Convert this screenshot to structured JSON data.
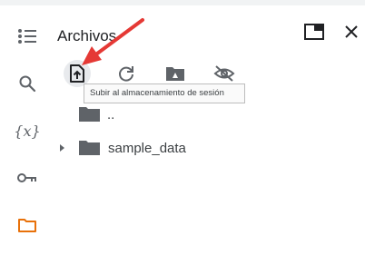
{
  "panel": {
    "title": "Archivos"
  },
  "toolbar": {
    "upload_tooltip": "Subir al almacenamiento de sesión"
  },
  "rail": {
    "items": [
      {
        "icon": "table-of-contents-icon"
      },
      {
        "icon": "search-icon"
      },
      {
        "icon": "variables-icon",
        "label": "{x}"
      },
      {
        "icon": "secrets-key-icon"
      },
      {
        "icon": "folder-icon",
        "active": true
      }
    ]
  },
  "tree": {
    "parent_label": "..",
    "items": [
      {
        "label": "sample_data",
        "type": "folder",
        "collapsed": true
      }
    ]
  },
  "colors": {
    "accent_orange": "#e8710a",
    "annotation_red": "#e53935",
    "icon_gray": "#5f6368"
  }
}
